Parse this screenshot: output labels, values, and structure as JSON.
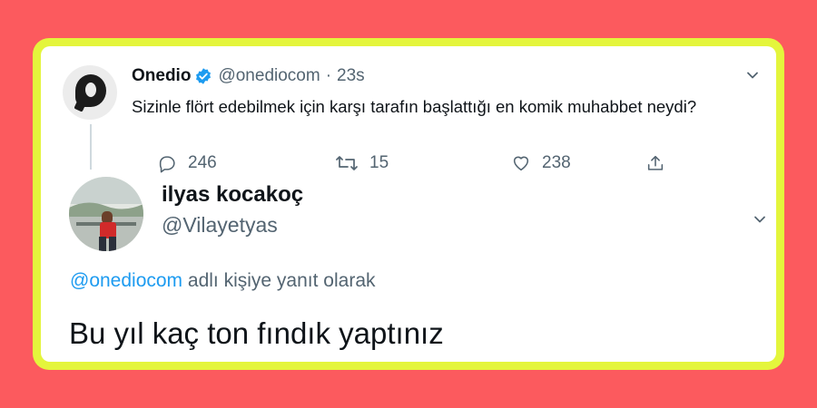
{
  "original_tweet": {
    "author_name": "Onedio",
    "handle": "@onediocom",
    "separator": "·",
    "time": "23s",
    "text": "Sizinle flört edebilmek için karşı tarafın başlattığı en komik muhabbet neydi?",
    "counts": {
      "replies": "246",
      "retweets": "15",
      "likes": "238"
    }
  },
  "reply_tweet": {
    "author_name": "ilyas kocakoç",
    "handle": "@Vilayetyas",
    "replying_mention": "@onediocom",
    "replying_suffix": " adlı kişiye yanıt olarak",
    "text": "Bu yıl kaç ton fındık yaptınız"
  },
  "colors": {
    "background": "#fc5a5e",
    "frame": "#e4f53c",
    "verified": "#1d9bf0",
    "mention": "#1d9bf0",
    "secondary_text": "#536471"
  },
  "icons": [
    "verified-badge-icon",
    "reply-icon",
    "retweet-icon",
    "like-icon",
    "share-icon",
    "chevron-down-icon"
  ]
}
